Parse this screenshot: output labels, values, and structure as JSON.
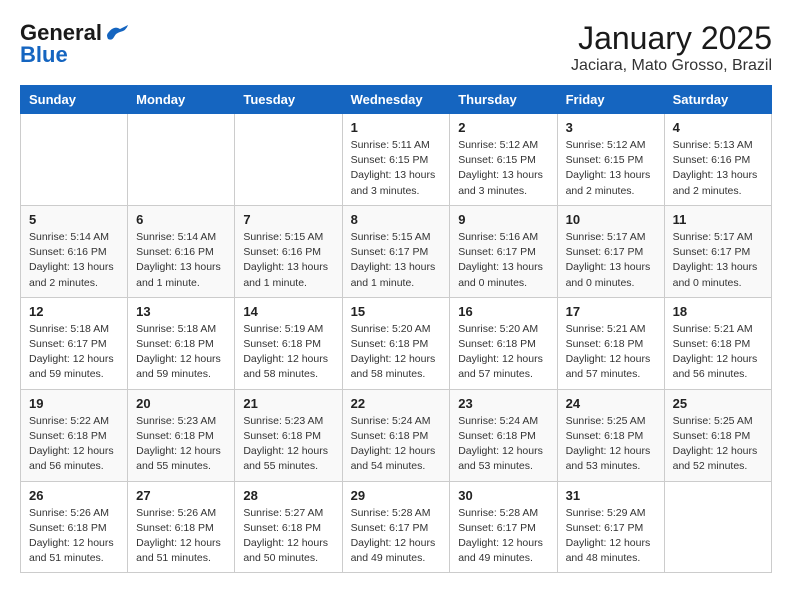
{
  "logo": {
    "line1": "General",
    "line2": "Blue"
  },
  "title": "January 2025",
  "subtitle": "Jaciara, Mato Grosso, Brazil",
  "weekdays": [
    "Sunday",
    "Monday",
    "Tuesday",
    "Wednesday",
    "Thursday",
    "Friday",
    "Saturday"
  ],
  "weeks": [
    [
      {
        "day": "",
        "info": ""
      },
      {
        "day": "",
        "info": ""
      },
      {
        "day": "",
        "info": ""
      },
      {
        "day": "1",
        "info": "Sunrise: 5:11 AM\nSunset: 6:15 PM\nDaylight: 13 hours\nand 3 minutes."
      },
      {
        "day": "2",
        "info": "Sunrise: 5:12 AM\nSunset: 6:15 PM\nDaylight: 13 hours\nand 3 minutes."
      },
      {
        "day": "3",
        "info": "Sunrise: 5:12 AM\nSunset: 6:15 PM\nDaylight: 13 hours\nand 2 minutes."
      },
      {
        "day": "4",
        "info": "Sunrise: 5:13 AM\nSunset: 6:16 PM\nDaylight: 13 hours\nand 2 minutes."
      }
    ],
    [
      {
        "day": "5",
        "info": "Sunrise: 5:14 AM\nSunset: 6:16 PM\nDaylight: 13 hours\nand 2 minutes."
      },
      {
        "day": "6",
        "info": "Sunrise: 5:14 AM\nSunset: 6:16 PM\nDaylight: 13 hours\nand 1 minute."
      },
      {
        "day": "7",
        "info": "Sunrise: 5:15 AM\nSunset: 6:16 PM\nDaylight: 13 hours\nand 1 minute."
      },
      {
        "day": "8",
        "info": "Sunrise: 5:15 AM\nSunset: 6:17 PM\nDaylight: 13 hours\nand 1 minute."
      },
      {
        "day": "9",
        "info": "Sunrise: 5:16 AM\nSunset: 6:17 PM\nDaylight: 13 hours\nand 0 minutes."
      },
      {
        "day": "10",
        "info": "Sunrise: 5:17 AM\nSunset: 6:17 PM\nDaylight: 13 hours\nand 0 minutes."
      },
      {
        "day": "11",
        "info": "Sunrise: 5:17 AM\nSunset: 6:17 PM\nDaylight: 13 hours\nand 0 minutes."
      }
    ],
    [
      {
        "day": "12",
        "info": "Sunrise: 5:18 AM\nSunset: 6:17 PM\nDaylight: 12 hours\nand 59 minutes."
      },
      {
        "day": "13",
        "info": "Sunrise: 5:18 AM\nSunset: 6:18 PM\nDaylight: 12 hours\nand 59 minutes."
      },
      {
        "day": "14",
        "info": "Sunrise: 5:19 AM\nSunset: 6:18 PM\nDaylight: 12 hours\nand 58 minutes."
      },
      {
        "day": "15",
        "info": "Sunrise: 5:20 AM\nSunset: 6:18 PM\nDaylight: 12 hours\nand 58 minutes."
      },
      {
        "day": "16",
        "info": "Sunrise: 5:20 AM\nSunset: 6:18 PM\nDaylight: 12 hours\nand 57 minutes."
      },
      {
        "day": "17",
        "info": "Sunrise: 5:21 AM\nSunset: 6:18 PM\nDaylight: 12 hours\nand 57 minutes."
      },
      {
        "day": "18",
        "info": "Sunrise: 5:21 AM\nSunset: 6:18 PM\nDaylight: 12 hours\nand 56 minutes."
      }
    ],
    [
      {
        "day": "19",
        "info": "Sunrise: 5:22 AM\nSunset: 6:18 PM\nDaylight: 12 hours\nand 56 minutes."
      },
      {
        "day": "20",
        "info": "Sunrise: 5:23 AM\nSunset: 6:18 PM\nDaylight: 12 hours\nand 55 minutes."
      },
      {
        "day": "21",
        "info": "Sunrise: 5:23 AM\nSunset: 6:18 PM\nDaylight: 12 hours\nand 55 minutes."
      },
      {
        "day": "22",
        "info": "Sunrise: 5:24 AM\nSunset: 6:18 PM\nDaylight: 12 hours\nand 54 minutes."
      },
      {
        "day": "23",
        "info": "Sunrise: 5:24 AM\nSunset: 6:18 PM\nDaylight: 12 hours\nand 53 minutes."
      },
      {
        "day": "24",
        "info": "Sunrise: 5:25 AM\nSunset: 6:18 PM\nDaylight: 12 hours\nand 53 minutes."
      },
      {
        "day": "25",
        "info": "Sunrise: 5:25 AM\nSunset: 6:18 PM\nDaylight: 12 hours\nand 52 minutes."
      }
    ],
    [
      {
        "day": "26",
        "info": "Sunrise: 5:26 AM\nSunset: 6:18 PM\nDaylight: 12 hours\nand 51 minutes."
      },
      {
        "day": "27",
        "info": "Sunrise: 5:26 AM\nSunset: 6:18 PM\nDaylight: 12 hours\nand 51 minutes."
      },
      {
        "day": "28",
        "info": "Sunrise: 5:27 AM\nSunset: 6:18 PM\nDaylight: 12 hours\nand 50 minutes."
      },
      {
        "day": "29",
        "info": "Sunrise: 5:28 AM\nSunset: 6:17 PM\nDaylight: 12 hours\nand 49 minutes."
      },
      {
        "day": "30",
        "info": "Sunrise: 5:28 AM\nSunset: 6:17 PM\nDaylight: 12 hours\nand 49 minutes."
      },
      {
        "day": "31",
        "info": "Sunrise: 5:29 AM\nSunset: 6:17 PM\nDaylight: 12 hours\nand 48 minutes."
      },
      {
        "day": "",
        "info": ""
      }
    ]
  ]
}
